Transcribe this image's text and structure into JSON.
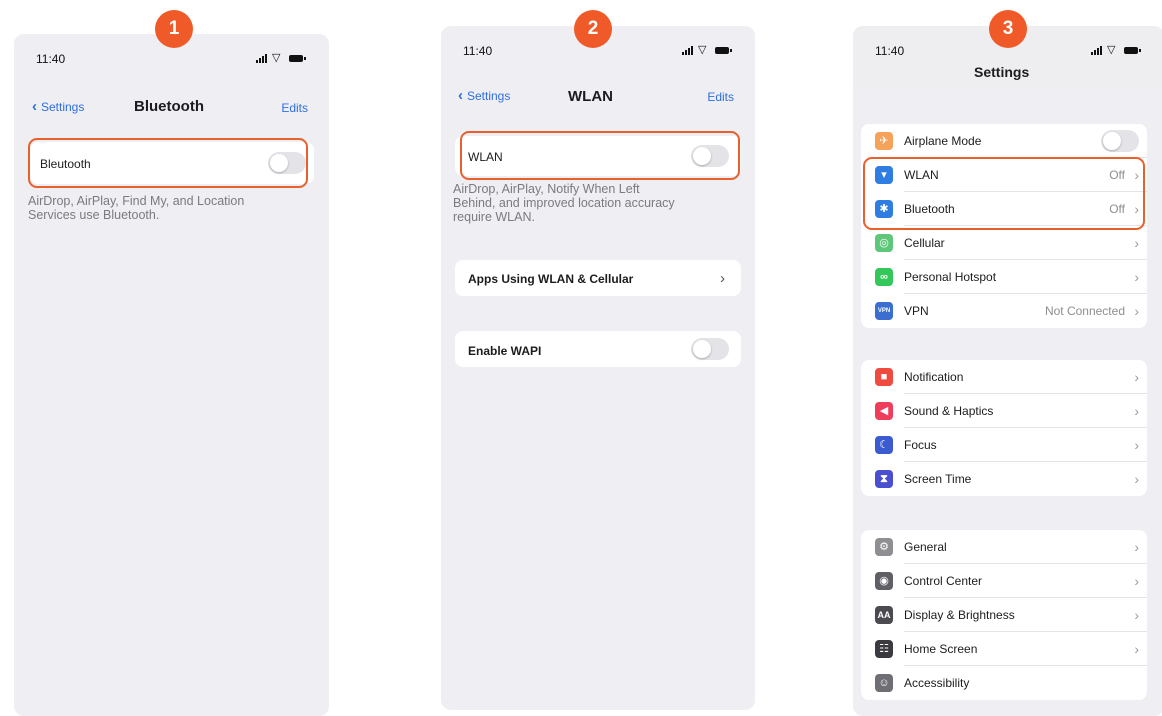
{
  "steps": [
    "1",
    "2",
    "3"
  ],
  "status_bar": {
    "time": "11:40"
  },
  "screen1": {
    "back_label": "Settings",
    "title": "Bluetooth",
    "right_action": "Edits",
    "row_label": "Bleutooth",
    "toggle_on": false,
    "footnote_line1": "AirDrop, AirPlay, Find My, and Location",
    "footnote_line2": "Services use Bluetooth."
  },
  "screen2": {
    "back_label": "Settings",
    "title": "WLAN",
    "right_action": "Edits",
    "wlan_label": "WLAN",
    "wlan_on": false,
    "footnote_line1": "AirDrop, AirPlay, Notify When Left",
    "footnote_line2": "Behind, and improved location accuracy",
    "footnote_line3": "require WLAN.",
    "apps_row": "Apps Using WLAN & Cellular",
    "wapi_row": "Enable WAPI",
    "wapi_on": false
  },
  "screen3": {
    "title": "Settings",
    "group1": [
      {
        "label": "Airplane Mode",
        "icon": "airplane-icon",
        "color": "#f5a25b"
      },
      {
        "label": "WLAN",
        "value": "Off",
        "icon": "wifi-icon",
        "color": "#2f7de1"
      },
      {
        "label": "Bluetooth",
        "value": "Off",
        "icon": "bluetooth-icon",
        "color": "#2f7de1"
      },
      {
        "label": "Cellular",
        "icon": "cellular-icon",
        "color": "#5ec77a"
      },
      {
        "label": "Personal Hotspot",
        "icon": "hotspot-icon",
        "color": "#34c759"
      },
      {
        "label": "VPN",
        "value": "Not Connected",
        "icon": "vpn-icon",
        "color": "#3a6fd0"
      }
    ],
    "group2": [
      {
        "label": "Notification",
        "icon": "notification-icon",
        "color": "#ef4b3f"
      },
      {
        "label": "Sound & Haptics",
        "icon": "sound-icon",
        "color": "#ef3e5b"
      },
      {
        "label": "Focus",
        "icon": "moon-icon",
        "color": "#3b5bd1"
      },
      {
        "label": "Screen Time",
        "icon": "hourglass-icon",
        "color": "#4a4fcf"
      }
    ],
    "group3": [
      {
        "label": "General",
        "icon": "gear-icon",
        "color": "#8e8e93"
      },
      {
        "label": "Control Center",
        "icon": "control-center-icon",
        "color": "#5f5f66"
      },
      {
        "label": "Display & Brightness",
        "icon": "display-icon",
        "color": "#4a4a50"
      },
      {
        "label": "Home Screen",
        "icon": "home-screen-icon",
        "color": "#3a3a40"
      },
      {
        "label": "Accessibility",
        "icon": "accessibility-icon",
        "color": "#6e6e74"
      }
    ]
  }
}
